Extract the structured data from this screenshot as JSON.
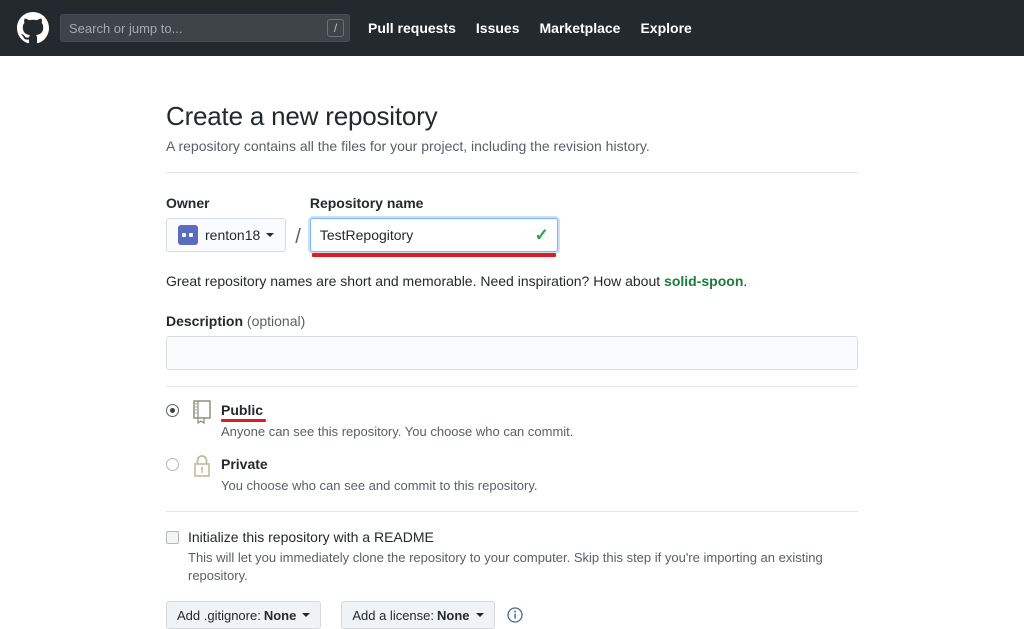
{
  "header": {
    "logo_name": "github-octocat-logo",
    "search": {
      "placeholder": "Search or jump to...",
      "value": "",
      "shortcut_key": "/"
    },
    "nav": [
      {
        "label": "Pull requests"
      },
      {
        "label": "Issues"
      },
      {
        "label": "Marketplace"
      },
      {
        "label": "Explore"
      }
    ],
    "background_color": "#24292e"
  },
  "main": {
    "title": "Create a new repository",
    "subtitle": "A repository contains all the files for your project, including the revision history.",
    "owner": {
      "label": "Owner",
      "name": "renton18"
    },
    "separator": "/",
    "repository": {
      "label": "Repository name",
      "value": "TestRepogitory",
      "valid_icon": "✓",
      "valid_color": "#28a745",
      "focus_border_color": "#79b8ff",
      "annotation_color": "#e01b24"
    },
    "hint": {
      "prefix": "Great repository names are short and memorable. Need inspiration? How about ",
      "suggestion": "solid-spoon",
      "suffix": ".",
      "suggestion_color": "#1c7c3c"
    },
    "description": {
      "label": "Description",
      "optional": "(optional)",
      "value": "",
      "placeholder": ""
    },
    "visibility": [
      {
        "id": "public",
        "title": "Public",
        "description": "Anyone can see this repository. You choose who can commit.",
        "selected": true,
        "icon": "repo-book-icon",
        "icon_color": "#8b8878",
        "annotated": true
      },
      {
        "id": "private",
        "title": "Private",
        "description": "You choose who can see and commit to this repository.",
        "selected": false,
        "icon": "lock-icon",
        "icon_color": "#c3b99a",
        "annotated": false
      }
    ],
    "readme": {
      "label": "Initialize this repository with a README",
      "description": "This will let you immediately clone the repository to your computer. Skip this step if you're importing an existing repository.",
      "checked": false
    },
    "footer_buttons": {
      "gitignore": {
        "prefix": "Add .gitignore:",
        "value": "None"
      },
      "license": {
        "prefix": "Add a license:",
        "value": "None"
      },
      "info_icon": "info-circle-icon",
      "info_icon_color": "#3f6e8c"
    }
  }
}
